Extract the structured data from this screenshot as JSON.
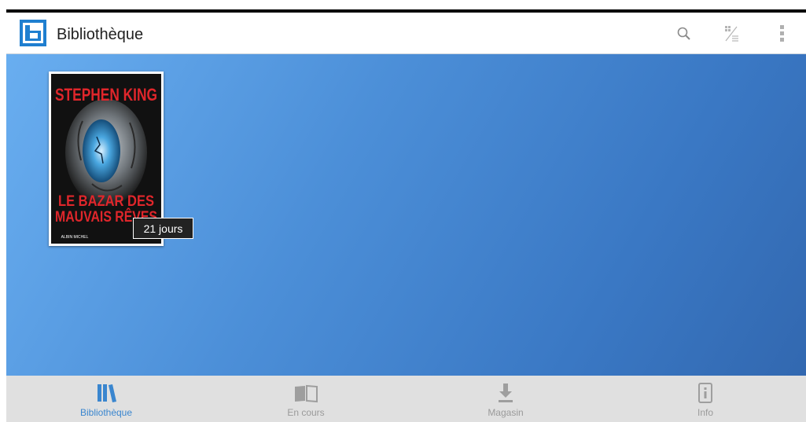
{
  "appbar": {
    "title": "Bibliothèque",
    "logo_icon": "bookeen-logo-icon",
    "actions": [
      {
        "name": "search-icon"
      },
      {
        "name": "sort-view-icon"
      },
      {
        "name": "more-vert-icon"
      }
    ]
  },
  "library": {
    "books": [
      {
        "author": "STEPHEN KING",
        "title_line1": "LE BAZAR DES",
        "title_line2": "MAUVAIS RÊVES",
        "publisher": "ALBIN MICHEL",
        "badge": "21 jours"
      }
    ]
  },
  "bottom_nav": {
    "items": [
      {
        "label": "Bibliothèque",
        "icon": "library-icon",
        "active": true
      },
      {
        "label": "En cours",
        "icon": "open-book-icon",
        "active": false
      },
      {
        "label": "Magasin",
        "icon": "download-icon",
        "active": false
      },
      {
        "label": "Info",
        "icon": "info-icon",
        "active": false
      }
    ]
  },
  "colors": {
    "accent": "#3a86cf",
    "logo": "#1f7fd0",
    "cover_red": "#e0262b",
    "badge_bg": "#222222"
  }
}
